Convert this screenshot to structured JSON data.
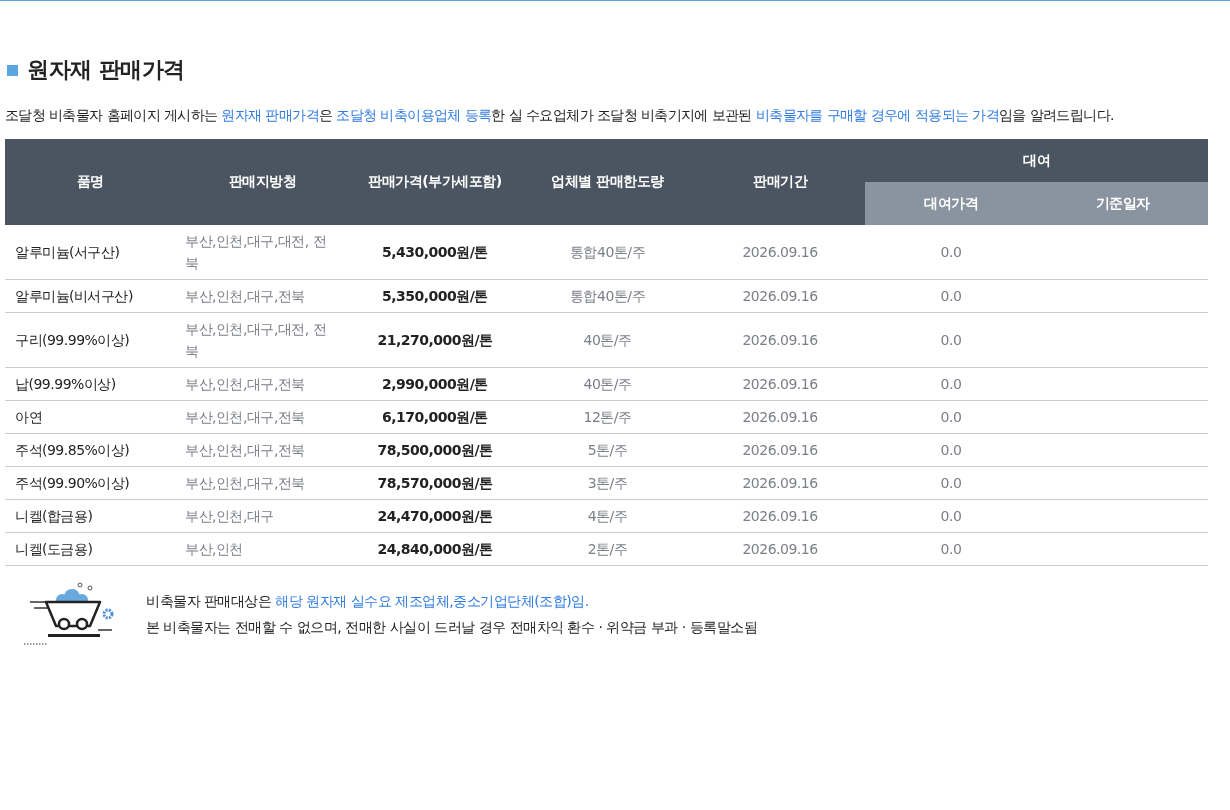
{
  "title": "원자재 판매가격",
  "intro": [
    {
      "text": "조달청 비축물자 홈페이지 게시하는 ",
      "emphasis": false
    },
    {
      "text": "원자재 판매가격",
      "emphasis": true
    },
    {
      "text": "은 ",
      "emphasis": false
    },
    {
      "text": "조달청 비축이용업체 등록",
      "emphasis": true
    },
    {
      "text": "한 실 수요업체가 조달청 비축기지에 보관된 ",
      "emphasis": false
    },
    {
      "text": "비축물자를 구매할 경우에 적용되는 가격",
      "emphasis": true
    },
    {
      "text": "임을 알려드립니다.",
      "emphasis": false
    }
  ],
  "table": {
    "columns": [
      "품명",
      "판매지방청",
      "판매가격(부가세포함)",
      "업체별 판매한도량",
      "판매기간"
    ],
    "group": {
      "label": "대여",
      "columns": [
        "대여가격",
        "기준일자"
      ]
    },
    "rows": [
      {
        "item": "알루미늄(서구산)",
        "offices": "부산,인천,대구,대전, 전북",
        "price": "5,430,000원/톤",
        "limit": "통합40톤/주",
        "period": "2026.09.16",
        "rental_price": "0.0"
      },
      {
        "item": "알루미늄(비서구산)",
        "offices": "부산,인천,대구,전북",
        "price": "5,350,000원/톤",
        "limit": "통합40톤/주",
        "period": "2026.09.16",
        "rental_price": "0.0"
      },
      {
        "item": "구리(99.99%이상)",
        "offices": "부산,인천,대구,대전, 전북",
        "price": "21,270,000원/톤",
        "limit": "40톤/주",
        "period": "2026.09.16",
        "rental_price": "0.0"
      },
      {
        "item": "납(99.99%이상)",
        "offices": "부산,인천,대구,전북",
        "price": "2,990,000원/톤",
        "limit": "40톤/주",
        "period": "2026.09.16",
        "rental_price": "0.0"
      },
      {
        "item": "아연",
        "offices": "부산,인천,대구,전북",
        "price": "6,170,000원/톤",
        "limit": "12톤/주",
        "period": "2026.09.16",
        "rental_price": "0.0"
      },
      {
        "item": "주석(99.85%이상)",
        "offices": "부산,인천,대구,전북",
        "price": "78,500,000원/톤",
        "limit": "5톤/주",
        "period": "2026.09.16",
        "rental_price": "0.0"
      },
      {
        "item": "주석(99.90%이상)",
        "offices": "부산,인천,대구,전북",
        "price": "78,570,000원/톤",
        "limit": "3톤/주",
        "period": "2026.09.16",
        "rental_price": "0.0"
      },
      {
        "item": "니켈(합금용)",
        "offices": "부산,인천,대구",
        "price": "24,470,000원/톤",
        "limit": "4톤/주",
        "period": "2026.09.16",
        "rental_price": "0.0"
      },
      {
        "item": "니켈(도금용)",
        "offices": "부산,인천",
        "price": "24,840,000원/톤",
        "limit": "2톤/주",
        "period": "2026.09.16",
        "rental_price": "0.0"
      }
    ]
  },
  "notes": [
    [
      {
        "text": "비축물자 판매대상은 ",
        "emphasis": false
      },
      {
        "text": "해당 원자재 실수요 제조업체,중소기업단체(조합)임.",
        "emphasis": true
      }
    ],
    [
      {
        "text": "본 비축물자는 전매할 수 없으며, 전매한 사실이 드러날 경우 전매차익 환수 · 위약금 부과 · 등록말소됨",
        "emphasis": false
      }
    ]
  ]
}
